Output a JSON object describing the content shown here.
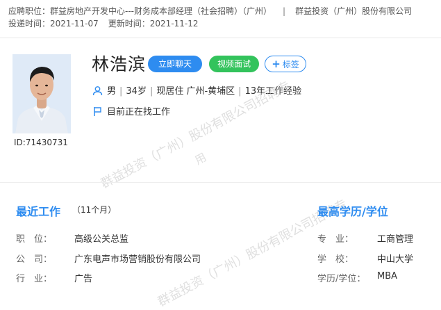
{
  "header": {
    "apply_label": "应聘职位：",
    "apply_job": "群益房地产开发中心---财务成本部经理（社会招聘）（广州）",
    "separator": "|",
    "company": "群益投资（广州）股份有限公司",
    "delivered_label": "投递时间：",
    "delivered_date": "2021-11-07",
    "updated_label": "更新时间：",
    "updated_date": "2021-11-12"
  },
  "candidate": {
    "name": "林浩滨",
    "id": "ID:71430731",
    "gender": "男",
    "age": "34岁",
    "residence": "现居住 广州-黄埔区",
    "experience": "13年工作经验",
    "status": "目前正在找工作"
  },
  "actions": {
    "chat": "立即聊天",
    "video": "视频面试",
    "tag_plus": "+",
    "tag": "标签"
  },
  "watermark": {
    "line1": "群益投资（广州）股份有限公司招聘专",
    "line2": "用"
  },
  "recent_work": {
    "title": "最近工作",
    "duration": "（11个月）",
    "position_label": "职　位：",
    "position": "高级公关总监",
    "company_label": "公　司：",
    "company": "广东电声市场营销股份有限公司",
    "industry_label": "行　业：",
    "industry": "广告"
  },
  "education": {
    "title": "最高学历/学位",
    "major_label": "专　业：",
    "major": "工商管理",
    "school_label": "学　校：",
    "school": "中山大学",
    "degree_label": "学历/学位：",
    "degree": "MBA"
  },
  "colors": {
    "accent_blue": "#2e8cf0",
    "accent_green": "#33c35c"
  }
}
